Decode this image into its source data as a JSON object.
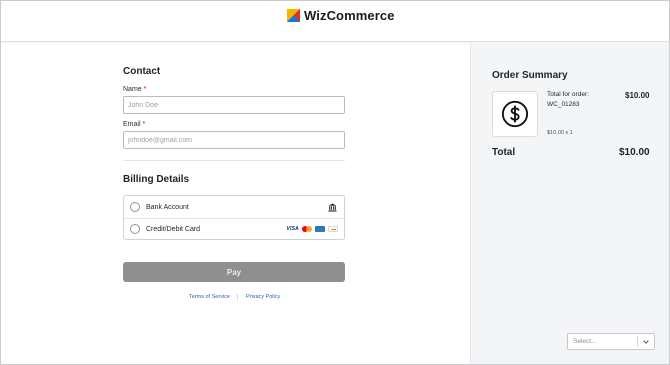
{
  "header": {
    "brand_name": "WizCommerce",
    "logo_icon": "wizcommerce-logo-icon"
  },
  "contact": {
    "title": "Contact",
    "name_label": "Name",
    "name_required": "*",
    "name_placeholder": "John Doe",
    "name_value": "",
    "email_label": "Email",
    "email_required": "*",
    "email_placeholder": "johndoe@gmail.com",
    "email_value": ""
  },
  "billing": {
    "title": "Billing Details",
    "options": [
      {
        "label": "Bank Account",
        "icon": "bank-icon",
        "selected": false
      },
      {
        "label": "Credit/Debit Card",
        "icons": [
          "visa-icon",
          "mastercard-icon",
          "amex-icon",
          "discover-icon"
        ],
        "selected": false
      }
    ],
    "visa_text": "VISA"
  },
  "pay_button": {
    "label": "Pay",
    "enabled": false
  },
  "footer_links": {
    "terms": "Terms of Service",
    "privacy": "Privacy Policy"
  },
  "order_summary": {
    "title": "Order Summary",
    "item": {
      "icon": "dollar-coin-icon",
      "line1": "Total for order:",
      "line2": "WC_01283",
      "price": "$10.00",
      "qty": "$10.00 x 1"
    },
    "total_label": "Total",
    "total_value": "$10.00"
  },
  "language_select": {
    "placeholder": "Select..."
  },
  "colors": {
    "pay_button_disabled": "#8e8f91",
    "link": "#2f5fa8",
    "required": "#d0021b",
    "summary_bg": "#f4f5f7"
  }
}
